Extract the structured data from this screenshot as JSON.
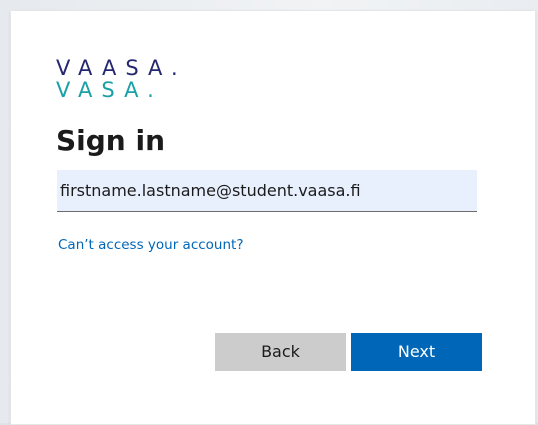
{
  "logo": {
    "line1": "VAASA.",
    "line2": "VASA.",
    "colors": {
      "line1": "#26286f",
      "line2": "#1aa0a6"
    }
  },
  "signin": {
    "title": "Sign in",
    "email_value": "firstname.lastname@student.vaasa.fi",
    "cant_access_link": "Can’t access your account?"
  },
  "buttons": {
    "back_label": "Back",
    "next_label": "Next"
  },
  "colors": {
    "accent": "#0067b8",
    "input_bg": "#e8f0fe",
    "back_button_bg": "#cccccc"
  }
}
